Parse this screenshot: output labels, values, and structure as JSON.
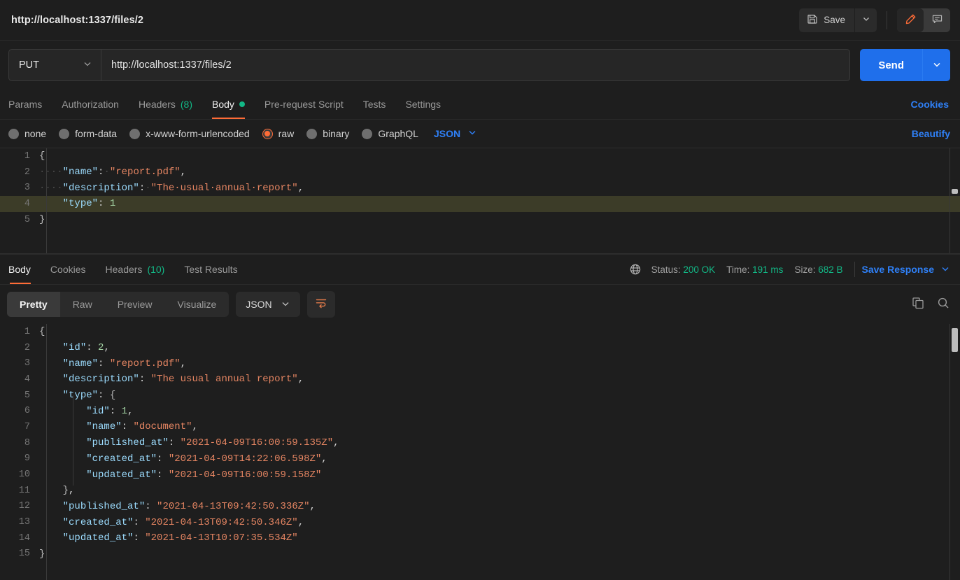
{
  "topbar": {
    "request_title": "http://localhost:1337/files/2",
    "save_label": "Save",
    "save_icon": "floppy-disk-icon",
    "save_caret_icon": "chevron-down-icon",
    "edit_icon": "pencil-icon",
    "comment_icon": "comment-icon",
    "accent_orange": "#ff6c37"
  },
  "urlbar": {
    "method": "PUT",
    "method_caret_icon": "chevron-down-icon",
    "url": "http://localhost:1337/files/2",
    "send_label": "Send",
    "send_caret_icon": "chevron-down-icon",
    "send_color": "#1f6feb"
  },
  "request_tabs": {
    "items": [
      {
        "label": "Params",
        "count": "",
        "active": false,
        "dot": false
      },
      {
        "label": "Authorization",
        "count": "",
        "active": false,
        "dot": false
      },
      {
        "label": "Headers",
        "count": "(8)",
        "active": false,
        "dot": false
      },
      {
        "label": "Body",
        "count": "",
        "active": true,
        "dot": true
      },
      {
        "label": "Pre-request Script",
        "count": "",
        "active": false,
        "dot": false
      },
      {
        "label": "Tests",
        "count": "",
        "active": false,
        "dot": false
      },
      {
        "label": "Settings",
        "count": "",
        "active": false,
        "dot": false
      }
    ],
    "cookies_label": "Cookies"
  },
  "body_types": {
    "options": [
      {
        "label": "none",
        "selected": false
      },
      {
        "label": "form-data",
        "selected": false
      },
      {
        "label": "x-www-form-urlencoded",
        "selected": false
      },
      {
        "label": "raw",
        "selected": true
      },
      {
        "label": "binary",
        "selected": false
      },
      {
        "label": "GraphQL",
        "selected": false
      }
    ],
    "format": "JSON",
    "format_caret_icon": "chevron-down-icon",
    "beautify_label": "Beautify"
  },
  "request_body": {
    "lines": [
      {
        "n": "1",
        "highlight": false,
        "tokens": [
          {
            "t": "fold",
            "v": "{"
          }
        ]
      },
      {
        "n": "2",
        "highlight": false,
        "tokens": [
          {
            "t": "ws",
            "v": "····"
          },
          {
            "t": "k",
            "v": "\"name\""
          },
          {
            "t": "p",
            "v": ":"
          },
          {
            "t": "ws",
            "v": "·"
          },
          {
            "t": "s",
            "v": "\"report.pdf\""
          },
          {
            "t": "p",
            "v": ","
          }
        ]
      },
      {
        "n": "3",
        "highlight": false,
        "tokens": [
          {
            "t": "ws",
            "v": "····"
          },
          {
            "t": "k",
            "v": "\"description\""
          },
          {
            "t": "p",
            "v": ":"
          },
          {
            "t": "ws",
            "v": "·"
          },
          {
            "t": "s",
            "v": "\"The·usual·annual·report\""
          },
          {
            "t": "p",
            "v": ","
          }
        ]
      },
      {
        "n": "4",
        "highlight": true,
        "tokens": [
          {
            "t": "ws",
            "v": "    "
          },
          {
            "t": "k",
            "v": "\"type\""
          },
          {
            "t": "p",
            "v": ": "
          },
          {
            "t": "n",
            "v": "1"
          }
        ]
      },
      {
        "n": "5",
        "highlight": false,
        "tokens": [
          {
            "t": "fold",
            "v": "}"
          }
        ]
      }
    ]
  },
  "response_tabs": {
    "items": [
      {
        "label": "Body",
        "count": "",
        "active": true
      },
      {
        "label": "Cookies",
        "count": "",
        "active": false
      },
      {
        "label": "Headers",
        "count": "(10)",
        "active": false
      },
      {
        "label": "Test Results",
        "count": "",
        "active": false
      }
    ],
    "globe_icon": "globe-icon",
    "status_label": "Status:",
    "status_value": "200 OK",
    "time_label": "Time:",
    "time_value": "191 ms",
    "size_label": "Size:",
    "size_value": "682 B",
    "save_response_label": "Save Response",
    "save_response_caret_icon": "chevron-down-icon",
    "green": "#12b886"
  },
  "response_tools": {
    "views": [
      {
        "label": "Pretty",
        "active": true
      },
      {
        "label": "Raw",
        "active": false
      },
      {
        "label": "Preview",
        "active": false
      },
      {
        "label": "Visualize",
        "active": false
      }
    ],
    "format": "JSON",
    "format_caret_icon": "chevron-down-icon",
    "wrap_icon": "word-wrap-icon",
    "copy_icon": "copy-icon",
    "search_icon": "search-icon"
  },
  "response_body": {
    "lines": [
      {
        "n": "1",
        "tokens": [
          {
            "t": "fold",
            "v": "{"
          }
        ]
      },
      {
        "n": "2",
        "tokens": [
          {
            "t": "p",
            "v": "    "
          },
          {
            "t": "k",
            "v": "\"id\""
          },
          {
            "t": "p",
            "v": ": "
          },
          {
            "t": "n",
            "v": "2"
          },
          {
            "t": "p",
            "v": ","
          }
        ]
      },
      {
        "n": "3",
        "tokens": [
          {
            "t": "p",
            "v": "    "
          },
          {
            "t": "k",
            "v": "\"name\""
          },
          {
            "t": "p",
            "v": ": "
          },
          {
            "t": "s",
            "v": "\"report.pdf\""
          },
          {
            "t": "p",
            "v": ","
          }
        ]
      },
      {
        "n": "4",
        "tokens": [
          {
            "t": "p",
            "v": "    "
          },
          {
            "t": "k",
            "v": "\"description\""
          },
          {
            "t": "p",
            "v": ": "
          },
          {
            "t": "s",
            "v": "\"The usual annual report\""
          },
          {
            "t": "p",
            "v": ","
          }
        ]
      },
      {
        "n": "5",
        "tokens": [
          {
            "t": "p",
            "v": "    "
          },
          {
            "t": "k",
            "v": "\"type\""
          },
          {
            "t": "p",
            "v": ": "
          },
          {
            "t": "fold",
            "v": "{"
          }
        ]
      },
      {
        "n": "6",
        "tokens": [
          {
            "t": "p",
            "v": "        "
          },
          {
            "t": "k",
            "v": "\"id\""
          },
          {
            "t": "p",
            "v": ": "
          },
          {
            "t": "n",
            "v": "1"
          },
          {
            "t": "p",
            "v": ","
          }
        ]
      },
      {
        "n": "7",
        "tokens": [
          {
            "t": "p",
            "v": "        "
          },
          {
            "t": "k",
            "v": "\"name\""
          },
          {
            "t": "p",
            "v": ": "
          },
          {
            "t": "s",
            "v": "\"document\""
          },
          {
            "t": "p",
            "v": ","
          }
        ]
      },
      {
        "n": "8",
        "tokens": [
          {
            "t": "p",
            "v": "        "
          },
          {
            "t": "k",
            "v": "\"published_at\""
          },
          {
            "t": "p",
            "v": ": "
          },
          {
            "t": "s",
            "v": "\"2021-04-09T16:00:59.135Z\""
          },
          {
            "t": "p",
            "v": ","
          }
        ]
      },
      {
        "n": "9",
        "tokens": [
          {
            "t": "p",
            "v": "        "
          },
          {
            "t": "k",
            "v": "\"created_at\""
          },
          {
            "t": "p",
            "v": ": "
          },
          {
            "t": "s",
            "v": "\"2021-04-09T14:22:06.598Z\""
          },
          {
            "t": "p",
            "v": ","
          }
        ]
      },
      {
        "n": "10",
        "tokens": [
          {
            "t": "p",
            "v": "        "
          },
          {
            "t": "k",
            "v": "\"updated_at\""
          },
          {
            "t": "p",
            "v": ": "
          },
          {
            "t": "s",
            "v": "\"2021-04-09T16:00:59.158Z\""
          }
        ]
      },
      {
        "n": "11",
        "tokens": [
          {
            "t": "p",
            "v": "    "
          },
          {
            "t": "fold",
            "v": "}"
          },
          {
            "t": "p",
            "v": ","
          }
        ]
      },
      {
        "n": "12",
        "tokens": [
          {
            "t": "p",
            "v": "    "
          },
          {
            "t": "k",
            "v": "\"published_at\""
          },
          {
            "t": "p",
            "v": ": "
          },
          {
            "t": "s",
            "v": "\"2021-04-13T09:42:50.336Z\""
          },
          {
            "t": "p",
            "v": ","
          }
        ]
      },
      {
        "n": "13",
        "tokens": [
          {
            "t": "p",
            "v": "    "
          },
          {
            "t": "k",
            "v": "\"created_at\""
          },
          {
            "t": "p",
            "v": ": "
          },
          {
            "t": "s",
            "v": "\"2021-04-13T09:42:50.346Z\""
          },
          {
            "t": "p",
            "v": ","
          }
        ]
      },
      {
        "n": "14",
        "tokens": [
          {
            "t": "p",
            "v": "    "
          },
          {
            "t": "k",
            "v": "\"updated_at\""
          },
          {
            "t": "p",
            "v": ": "
          },
          {
            "t": "s",
            "v": "\"2021-04-13T10:07:35.534Z\""
          }
        ]
      },
      {
        "n": "15",
        "tokens": [
          {
            "t": "fold",
            "v": "}"
          }
        ]
      }
    ]
  }
}
